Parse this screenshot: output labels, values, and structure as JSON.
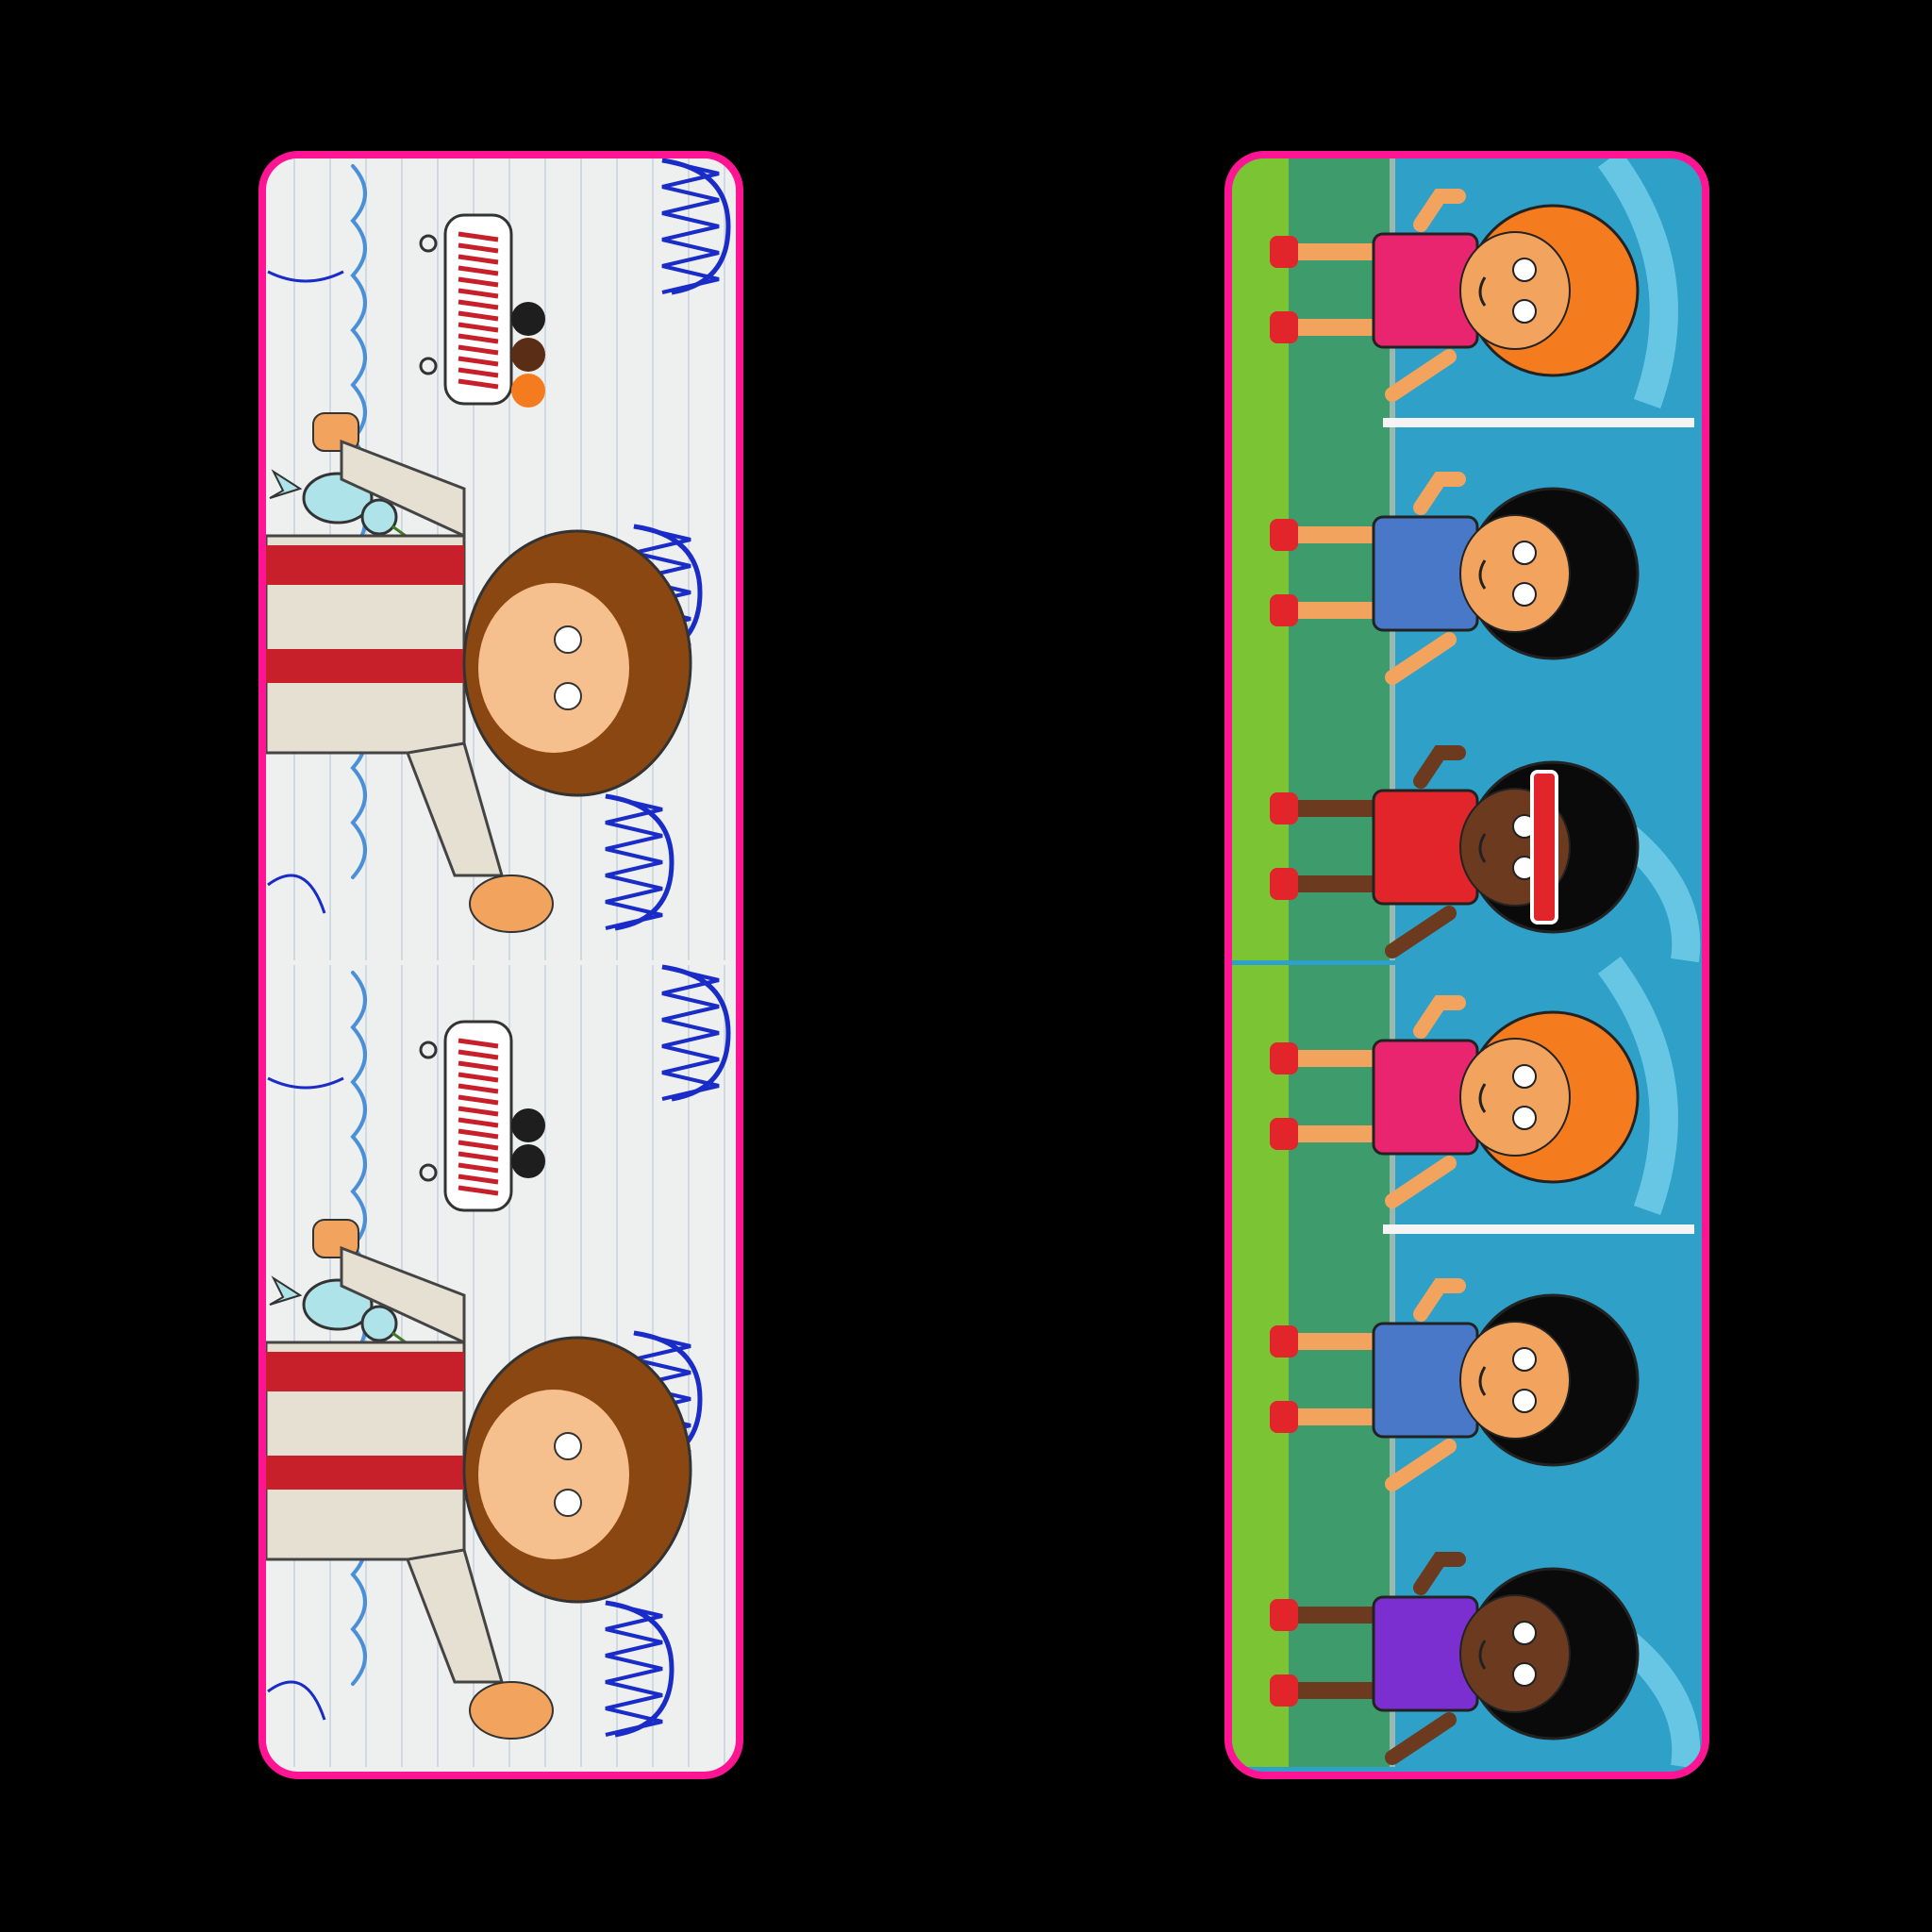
{
  "colors": {
    "background": "#000000",
    "card_border": "#FF1493",
    "paper": "#EEEFEF",
    "paper_line": "#C7D3E0",
    "cloud_line": "#4A90D9",
    "scribble_blue": "#1A2CC8",
    "robe_white": "#E6E0D3",
    "sash_red": "#C8202A",
    "hair_brown": "#8A4712",
    "skin_light": "#F5C08E",
    "bird_blue": "#AEE3EA",
    "grass_green": "#7BC433",
    "path_green": "#3E9B6B",
    "pool_blue": "#2FA0C8",
    "pool_light": "#7FD6EE",
    "hair_orange": "#F57C1E",
    "hair_black": "#0A0A0A",
    "shirt_pink": "#E8256E",
    "shirt_blue": "#4A78C8",
    "shirt_red": "#E2252A",
    "shirt_purple": "#7B2FD0",
    "skin_dark": "#6B3A1F",
    "skin_tan": "#F2A45E"
  },
  "cards": [
    {
      "name": "paper-sky-scene-card",
      "panels": [
        "top-panel",
        "bottom-panel"
      ]
    },
    {
      "name": "pool-children-scene-card",
      "panels": [
        "top-panel",
        "bottom-panel"
      ]
    }
  ]
}
